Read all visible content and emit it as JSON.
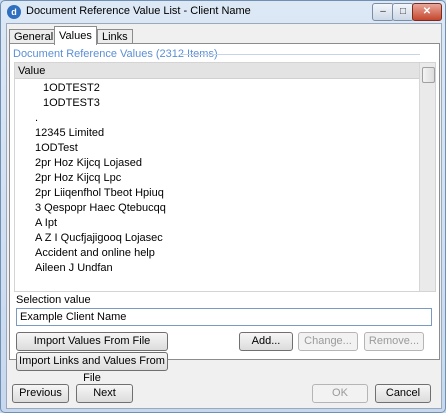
{
  "window": {
    "title": "Document Reference Value List - Client Name",
    "icon": "app-icon"
  },
  "titlebar_buttons": {
    "minimize": "minimize-icon",
    "maximize": "maximize-icon",
    "close": "close-icon"
  },
  "tabs": [
    {
      "label": "General"
    },
    {
      "label": "Values"
    },
    {
      "label": "Links"
    }
  ],
  "active_tab": "Values",
  "values_group": {
    "title": "Document Reference Values (2312 Items)",
    "column_header": "Value",
    "items": [
      "1ODTEST2",
      "1ODTEST3",
      ".",
      "12345 Limited",
      "1ODTest",
      "2pr Hoz Kijcq Lojased",
      "2pr Hoz Kijcq Lpc",
      "2pr Liiqenfhol Tbeot Hpiuq",
      "3 Qespopr Haec Qtebucqq",
      "A Ipt",
      "A Z I Qucfjajigooq Lojasec",
      "Accident and online help",
      "Aileen J Undfan"
    ]
  },
  "selection": {
    "label": "Selection value",
    "value": "Example Client Name"
  },
  "buttons": {
    "import_values": "Import Values From File",
    "import_links": "Import Links and Values From File",
    "add": "Add...",
    "change": "Change...",
    "remove": "Remove...",
    "previous": "Previous",
    "next": "Next",
    "ok": "OK",
    "cancel": "Cancel"
  }
}
